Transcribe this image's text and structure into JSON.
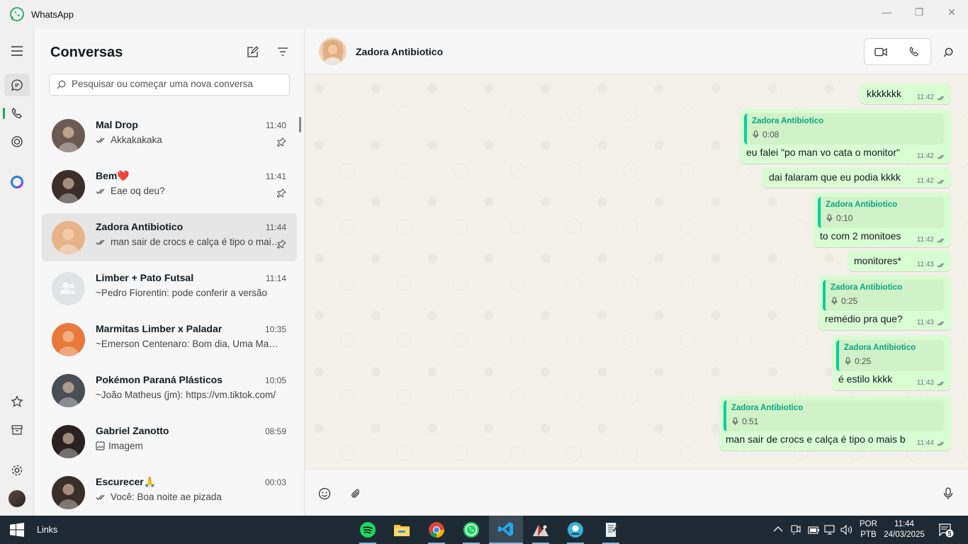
{
  "window": {
    "title": "WhatsApp",
    "minimize_icon": "—",
    "restore_icon": "❐",
    "close_icon": "✕"
  },
  "sidebar": {
    "items": [
      {
        "name": "menu",
        "icon": "hamburger-icon"
      },
      {
        "name": "chats",
        "icon": "chat-icon",
        "active": true
      },
      {
        "name": "calls",
        "icon": "phone-icon"
      },
      {
        "name": "status",
        "icon": "status-icon"
      },
      {
        "name": "meta-ai",
        "icon": "meta-ai-icon"
      },
      {
        "name": "starred",
        "icon": "star-icon"
      },
      {
        "name": "archived",
        "icon": "archive-icon"
      },
      {
        "name": "settings",
        "icon": "gear-icon"
      },
      {
        "name": "profile",
        "icon": "avatar"
      }
    ]
  },
  "chat_list": {
    "title": "Conversas",
    "search_placeholder": "Pesquisar ou começar uma nova conversa",
    "chats": [
      {
        "name": "Mal Drop",
        "time": "11:40",
        "preview": "Akkakakaka",
        "tick": true,
        "pinned": true,
        "avatar_color": "#6b5a52"
      },
      {
        "name": "Bem❤️",
        "time": "11:41",
        "preview": "Eae oq deu?",
        "tick": true,
        "pinned": true,
        "avatar_color": "#3b2e2a"
      },
      {
        "name": "Zadora Antibiotico",
        "time": "11:44",
        "preview": "man sair de crocs e calça é tipo o mais b",
        "tick": true,
        "pinned": true,
        "selected": true,
        "avatar_color": "#e7b48a"
      },
      {
        "name": "Limber + Pato Futsal",
        "time": "11:14",
        "preview": "~Pedro Fiorentin: pode conferir a versão",
        "tick": false,
        "pinned": false,
        "avatar_color": "#dfe5e7"
      },
      {
        "name": "Marmitas Limber x Paladar",
        "time": "10:35",
        "preview": "~Emerson Centenaro: Bom dia, Uma Marmita",
        "tick": false,
        "pinned": false,
        "avatar_color": "#e8793a"
      },
      {
        "name": "Pokémon Paraná Plásticos",
        "time": "10:05",
        "preview": "~João Matheus (jm): https://vm.tiktok.com/",
        "tick": false,
        "pinned": false,
        "avatar_color": "#4a4f55"
      },
      {
        "name": "Gabriel Zanotto",
        "time": "08:59",
        "preview": "Imagem",
        "tick": false,
        "image": true,
        "pinned": false,
        "avatar_color": "#2a2222"
      },
      {
        "name": "Escurecer🙏",
        "time": "00:03",
        "preview": "Você: Boa noite ae pizada",
        "tick": true,
        "pinned": false,
        "avatar_color": "#3a2e28"
      }
    ]
  },
  "conversation": {
    "contact_name": "Zadora Antibiotico",
    "video_call_icon": "video-icon",
    "voice_call_icon": "phone-icon",
    "search_icon": "search-icon",
    "messages": [
      {
        "text": "kkkkkkk",
        "time": "11:42"
      },
      {
        "text": "eu falei \"po man vo cata o monitor\"",
        "time": "11:42",
        "quote_name": "Zadora Antibiotico",
        "quote_duration": "0:08"
      },
      {
        "text": "dai falaram que eu podia kkkk",
        "time": "11:42"
      },
      {
        "text": "to com 2 monitoes",
        "time": "11:42",
        "quote_name": "Zadora Antibiotico",
        "quote_duration": "0:10"
      },
      {
        "text": "monitores*",
        "time": "11:43"
      },
      {
        "text": "remédio pra que?",
        "time": "11:43",
        "quote_name": "Zadora Antibiotico",
        "quote_duration": "0:25"
      },
      {
        "text": "é estilo kkkk",
        "time": "11:43",
        "quote_name": "Zadora Antibiotico",
        "quote_duration": "0:25"
      },
      {
        "text": "man sair de crocs e calça é tipo o mais b",
        "time": "11:44",
        "quote_name": "Zadora Antibiotico",
        "quote_duration": "0:51"
      }
    ],
    "composer": {
      "emoji_icon": "emoji-icon",
      "attach_icon": "paperclip-icon",
      "mic_icon": "microphone-icon"
    }
  },
  "taskbar": {
    "links_label": "Links",
    "apps": [
      "spotify-icon",
      "file-explorer-icon",
      "chrome-icon",
      "whatsapp-icon",
      "vscode-icon",
      "app-icon",
      "app-icon-2",
      "notepad-icon"
    ],
    "lang_line1": "POR",
    "lang_line2": "PTB",
    "time": "11:44",
    "date": "24/03/2025",
    "notification_count": "5"
  }
}
